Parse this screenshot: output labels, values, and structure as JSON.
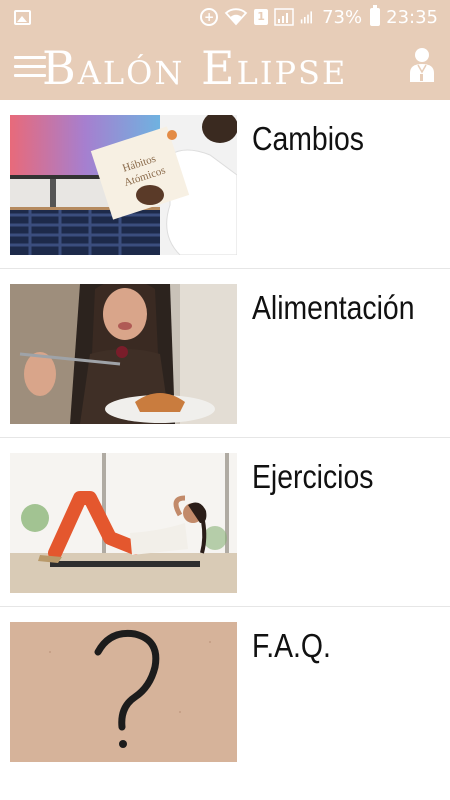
{
  "status_bar": {
    "battery": "73%",
    "time": "23:35",
    "sim_badge": "1",
    "icons": [
      "gallery-icon",
      "sync-icon",
      "wifi-icon",
      "signal-icon",
      "battery-icon"
    ]
  },
  "app_bar": {
    "title": "Balón Elipse",
    "menu_icon": "hamburger-menu-icon",
    "profile_icon": "user-profile-icon"
  },
  "colors": {
    "header_background": "#e7cdb8",
    "header_foreground": "#ffffff",
    "list_text": "#111111",
    "divider": "#e6e6e6"
  },
  "menu_items": [
    {
      "label": "Cambios",
      "image": "person-reading-book-photo"
    },
    {
      "label": "Alimentación",
      "image": "woman-eating-photo"
    },
    {
      "label": "Ejercicios",
      "image": "woman-doing-crunches-photo"
    },
    {
      "label": "F.A.Q.",
      "image": "question-mark-photo"
    }
  ]
}
